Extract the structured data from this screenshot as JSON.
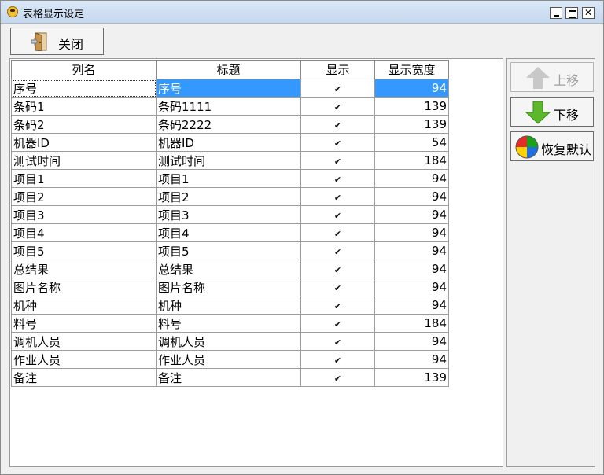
{
  "window": {
    "title": "表格显示设定"
  },
  "toolbar": {
    "close_label": "关闭"
  },
  "grid": {
    "headers": [
      "列名",
      "标题",
      "显示",
      "显示宽度"
    ],
    "rows": [
      {
        "name": "序号",
        "title": "序号",
        "show": true,
        "width": "94"
      },
      {
        "name": "条码1",
        "title": "条码1111",
        "show": true,
        "width": "139"
      },
      {
        "name": "条码2",
        "title": "条码2222",
        "show": true,
        "width": "139"
      },
      {
        "name": "机器ID",
        "title": "机器ID",
        "show": true,
        "width": "54"
      },
      {
        "name": "测试时间",
        "title": "测试时间",
        "show": true,
        "width": "184"
      },
      {
        "name": "项目1",
        "title": "项目1",
        "show": true,
        "width": "94"
      },
      {
        "name": "项目2",
        "title": "项目2",
        "show": true,
        "width": "94"
      },
      {
        "name": "项目3",
        "title": "项目3",
        "show": true,
        "width": "94"
      },
      {
        "name": "项目4",
        "title": "项目4",
        "show": true,
        "width": "94"
      },
      {
        "name": "项目5",
        "title": "项目5",
        "show": true,
        "width": "94"
      },
      {
        "name": "总结果",
        "title": "总结果",
        "show": true,
        "width": "94"
      },
      {
        "name": "图片名称",
        "title": "图片名称",
        "show": true,
        "width": "94"
      },
      {
        "name": "机种",
        "title": "机种",
        "show": true,
        "width": "94"
      },
      {
        "name": "料号",
        "title": "料号",
        "show": true,
        "width": "184"
      },
      {
        "name": "调机人员",
        "title": "调机人员",
        "show": true,
        "width": "94"
      },
      {
        "name": "作业人员",
        "title": "作业人员",
        "show": true,
        "width": "94"
      },
      {
        "name": "备注",
        "title": "备注",
        "show": true,
        "width": "139"
      }
    ],
    "selected_row_index": 0
  },
  "side_buttons": {
    "move_up": "上移",
    "move_down": "下移",
    "restore_default": "恢复默认"
  },
  "colors": {
    "selection": "#3399ff",
    "arrow_up_disabled": "#c8c8c8",
    "arrow_down": "#5bb82a"
  },
  "icons": {
    "close": "door-exit-icon",
    "up": "arrow-up-icon",
    "down": "arrow-down-icon",
    "reset": "color-ball-icon"
  }
}
